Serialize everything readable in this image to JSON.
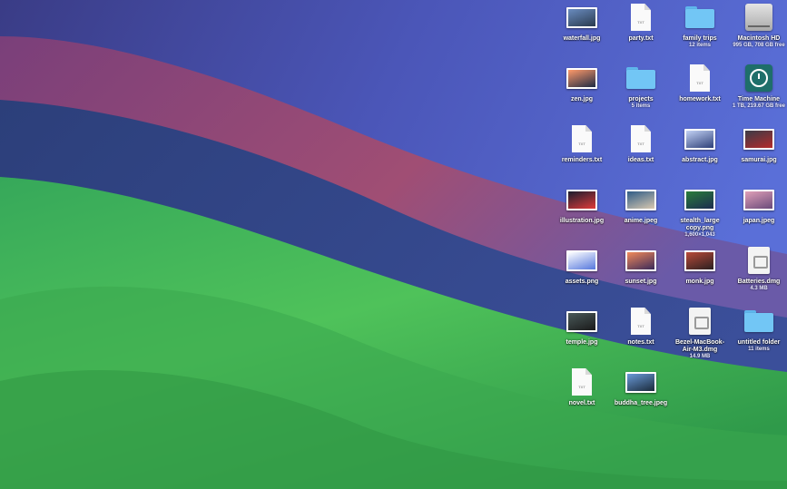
{
  "desktop": {
    "items": [
      {
        "name": "waterfall.jpg",
        "kind": "image",
        "colors": [
          "#6a8cc0",
          "#2a3b4e"
        ]
      },
      {
        "name": "party.txt",
        "kind": "text"
      },
      {
        "name": "family trips",
        "kind": "folder",
        "info": "12 items"
      },
      {
        "name": "Macintosh HD",
        "kind": "disk",
        "info": "995 GB, 708 GB free"
      },
      {
        "name": "zen.jpg",
        "kind": "image",
        "colors": [
          "#ff9a6a",
          "#1d2a44"
        ]
      },
      {
        "name": "projects",
        "kind": "folder",
        "info": "5 items"
      },
      {
        "name": "homework.txt",
        "kind": "text"
      },
      {
        "name": "Time Machine",
        "kind": "timemachine",
        "info": "1 TB, 219.67 GB free"
      },
      {
        "name": "reminders.txt",
        "kind": "text"
      },
      {
        "name": "ideas.txt",
        "kind": "text"
      },
      {
        "name": "abstract.jpg",
        "kind": "image",
        "colors": [
          "#c3d2f5",
          "#2d3f78"
        ]
      },
      {
        "name": "samurai.jpg",
        "kind": "image",
        "colors": [
          "#3a3c48",
          "#b52a2a"
        ]
      },
      {
        "name": "illustration.jpg",
        "kind": "image",
        "colors": [
          "#1a1c2e",
          "#e03a3a"
        ]
      },
      {
        "name": "anime.jpeg",
        "kind": "image",
        "colors": [
          "#2f5c86",
          "#d8c8b0"
        ]
      },
      {
        "name": "stealth_large copy.png",
        "kind": "image",
        "info": "1,600×1,043",
        "colors": [
          "#2a7d3a",
          "#1c2c50"
        ]
      },
      {
        "name": "japan.jpeg",
        "kind": "image",
        "colors": [
          "#e0a0b8",
          "#6a4a7a"
        ]
      },
      {
        "name": "assets.png",
        "kind": "image",
        "colors": [
          "#ffffff",
          "#5577dd"
        ]
      },
      {
        "name": "sunset.jpg",
        "kind": "image",
        "colors": [
          "#f28a5a",
          "#3a2a5a"
        ]
      },
      {
        "name": "monk.jpg",
        "kind": "image",
        "colors": [
          "#b84a3a",
          "#2a2020"
        ]
      },
      {
        "name": "Batteries.dmg",
        "kind": "dmg",
        "info": "4.3 MB"
      },
      {
        "name": "temple.jpg",
        "kind": "image",
        "colors": [
          "#4a5a5a",
          "#1a1a1a"
        ]
      },
      {
        "name": "notes.txt",
        "kind": "text"
      },
      {
        "name": "Bezel-MacBook-Air-M3.dmg",
        "kind": "dmg",
        "info": "14.9 MB"
      },
      {
        "name": "untitled folder",
        "kind": "folder",
        "info": "11 items"
      },
      {
        "name": "novel.txt",
        "kind": "text"
      },
      {
        "name": "buddha_tree.jpeg",
        "kind": "image",
        "colors": [
          "#6a9ad8",
          "#1a2a3a"
        ]
      }
    ],
    "txt_badge": "TXT"
  }
}
